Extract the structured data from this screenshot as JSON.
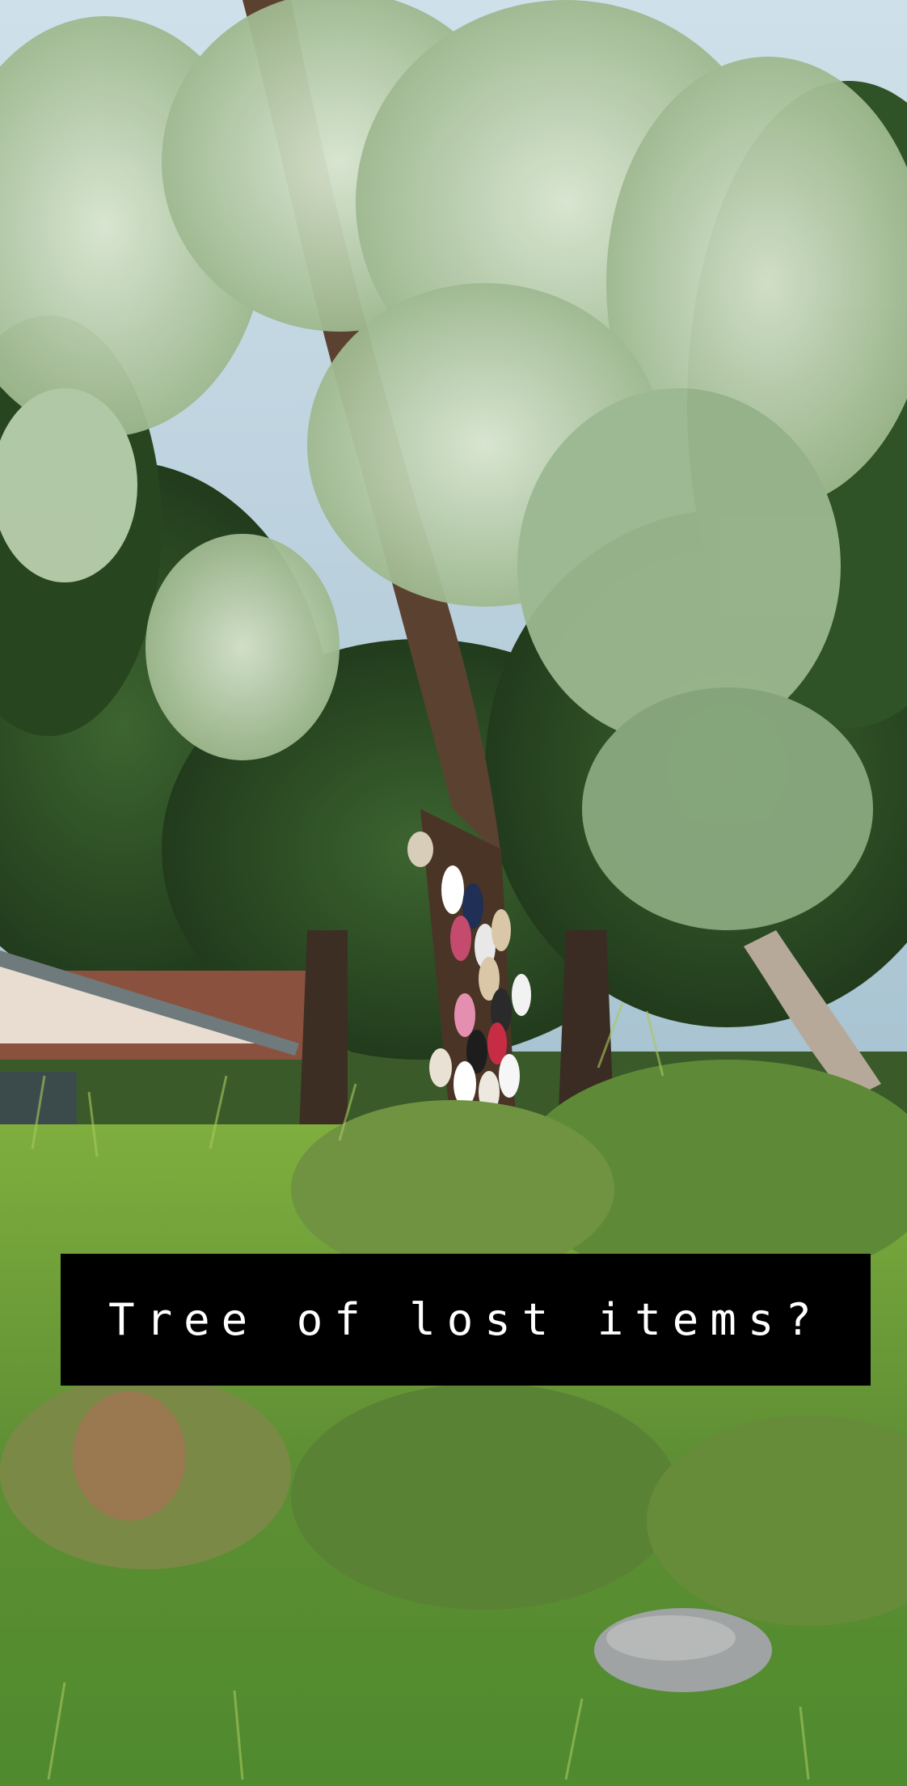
{
  "caption": {
    "text": "Tree of lost items?"
  },
  "colors": {
    "caption_background": "#000000",
    "caption_text": "#ffffff"
  }
}
